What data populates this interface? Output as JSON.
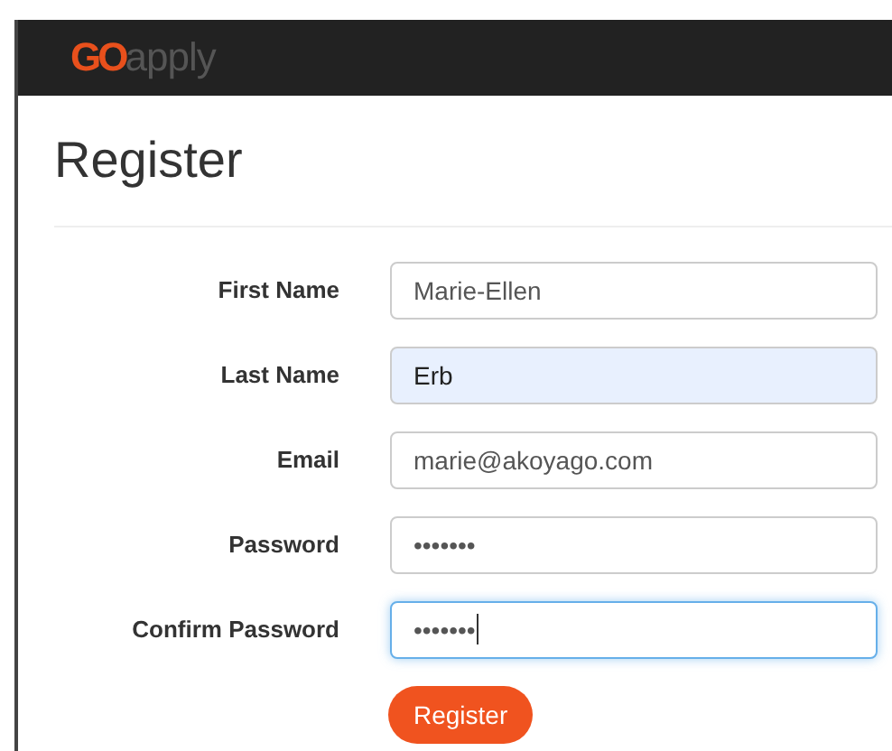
{
  "navbar": {
    "logo_mark": "GO",
    "logo_text": "apply"
  },
  "heading": "Register",
  "fields": [
    {
      "label": "First Name",
      "value": "Marie-Ellen",
      "autofilled": false,
      "focused": false
    },
    {
      "label": "Last Name",
      "value": "Erb",
      "autofilled": true,
      "focused": false
    },
    {
      "label": "Email",
      "value": "marie@akoyago.com",
      "autofilled": false,
      "focused": false
    },
    {
      "label": "Password",
      "value": "•••••••",
      "autofilled": false,
      "focused": false
    },
    {
      "label": "Confirm Password",
      "value": "•••••••",
      "autofilled": false,
      "focused": true
    }
  ],
  "submit": "Register"
}
